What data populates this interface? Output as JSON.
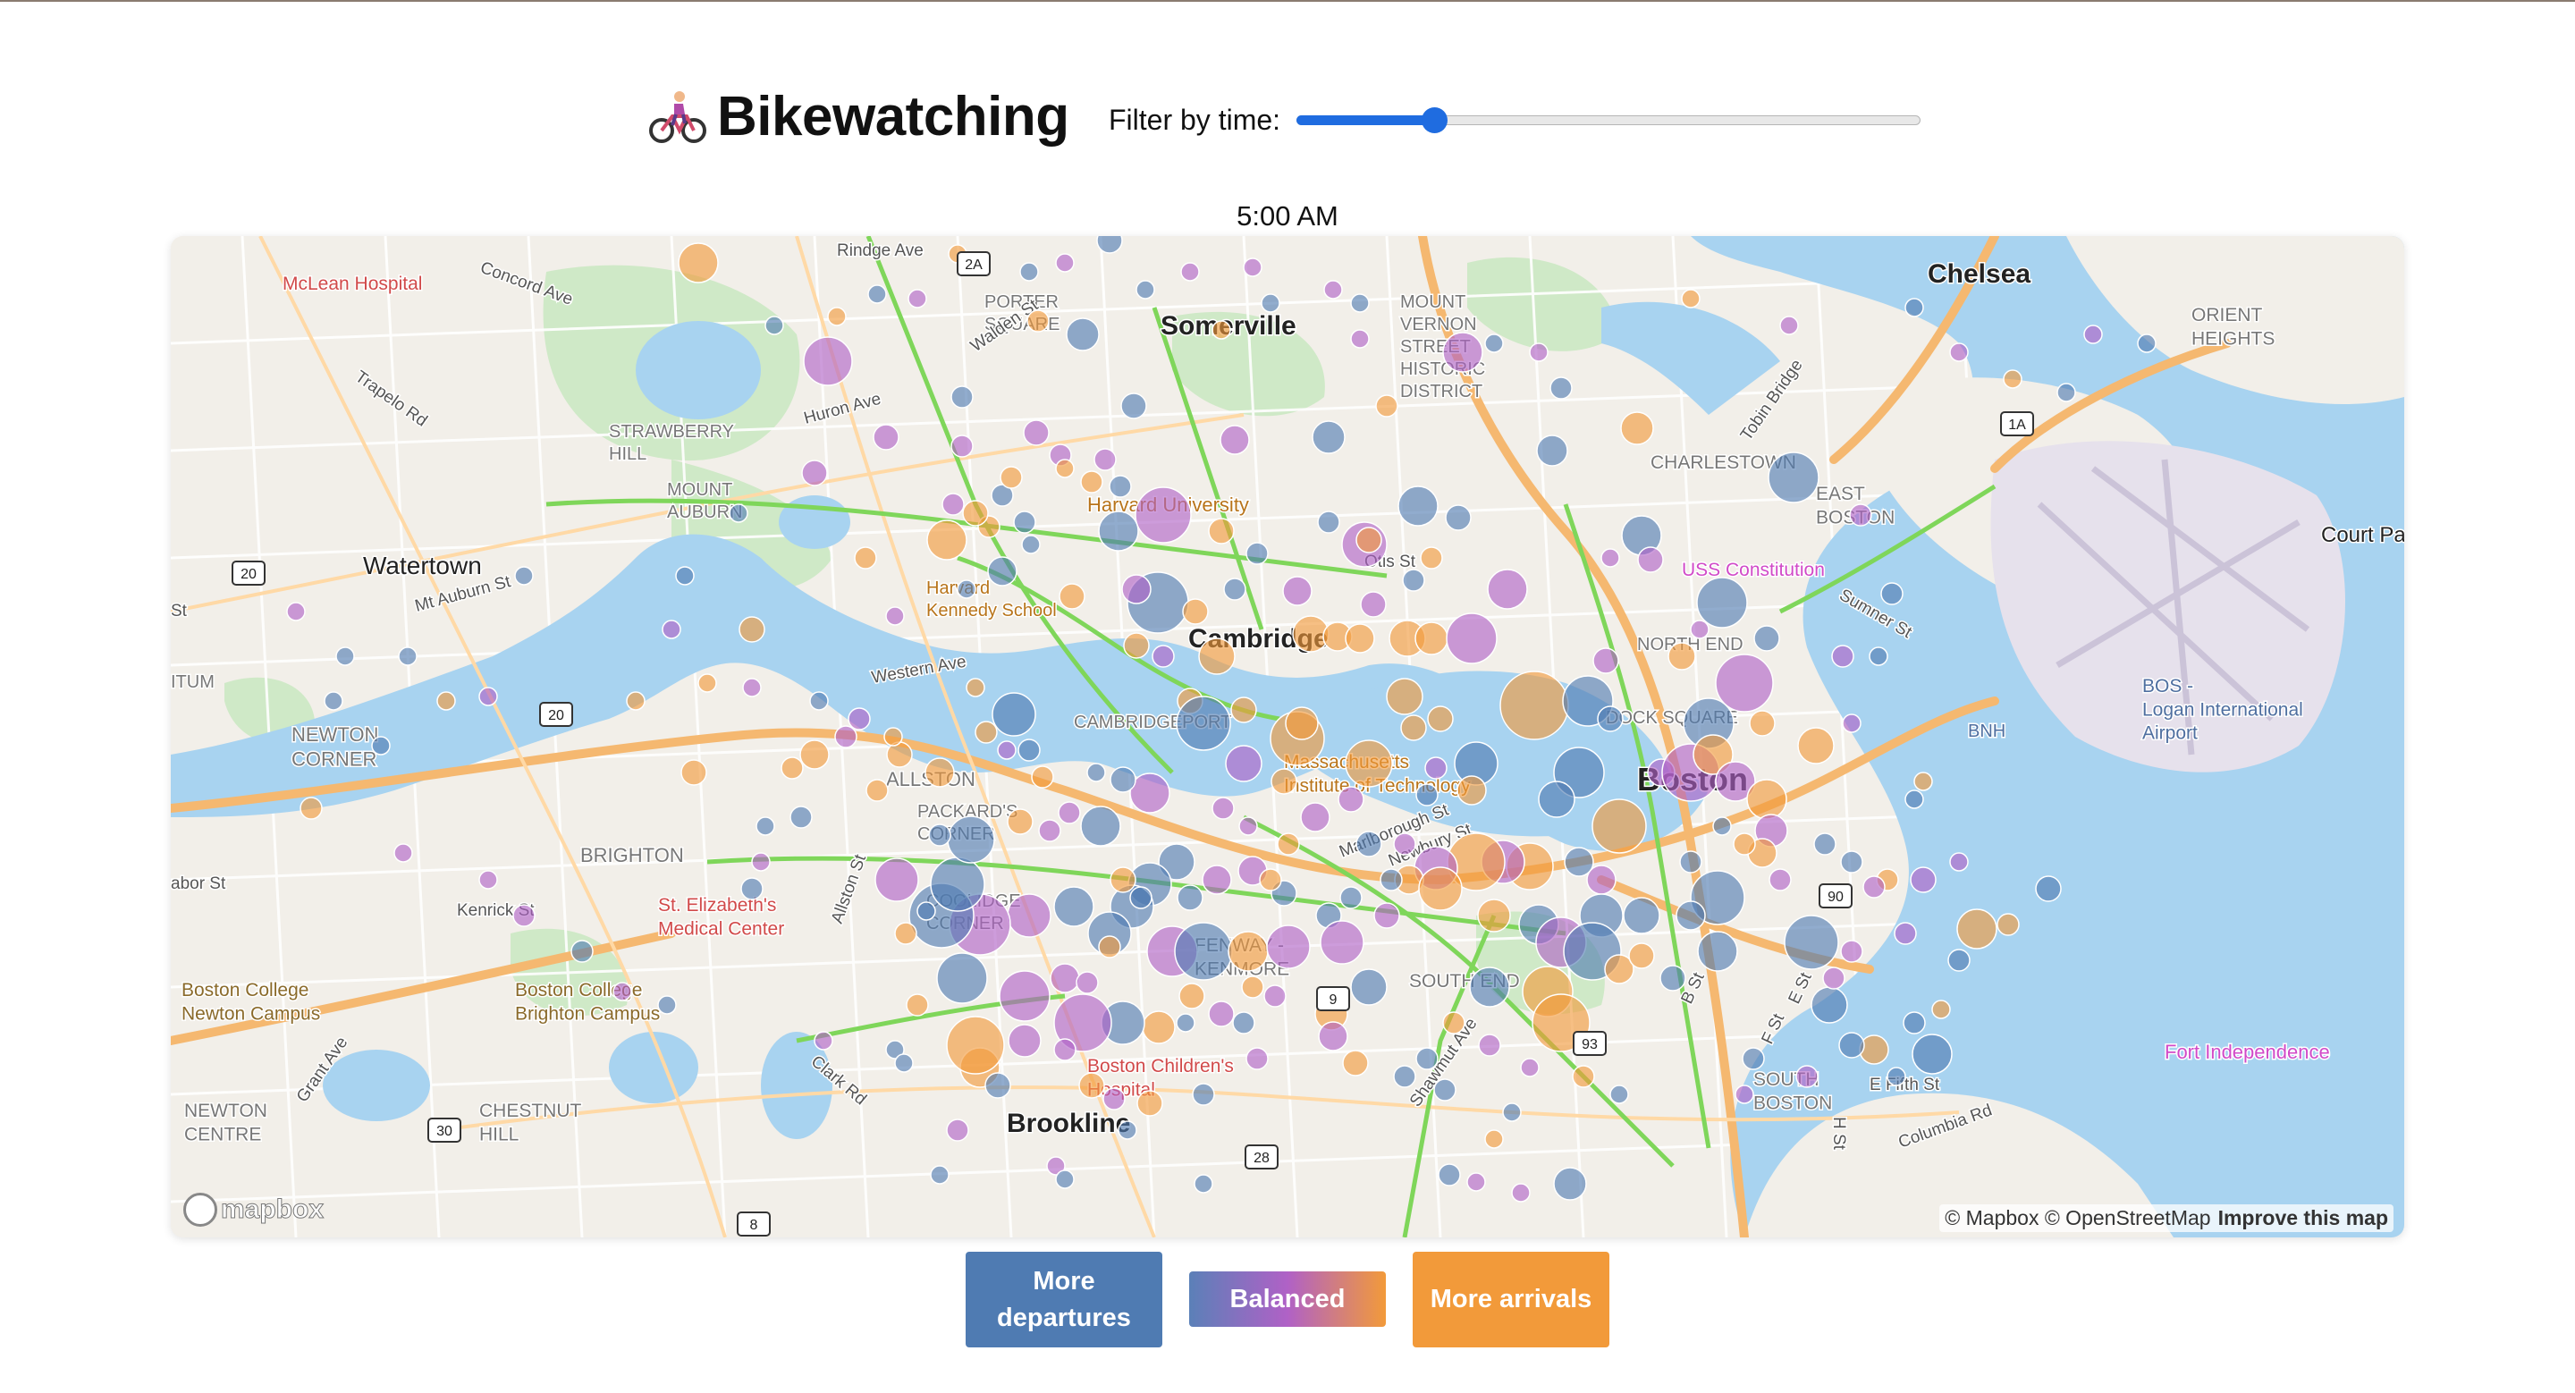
{
  "header": {
    "title": "Bikewatching",
    "title_icon": "bicyclist-icon",
    "filter_label": "Filter by time:",
    "time_value": "5:00 AM",
    "slider_fraction": 0.22
  },
  "map": {
    "attribution": "© Mapbox © OpenStreetMap",
    "improve_label": "Improve this map",
    "logo_text": "mapbox",
    "colors": {
      "water": "#a8d3f0",
      "land": "#f2efe9",
      "park": "#cfe9c7",
      "highway": "#f5b870",
      "bikeway": "#7fd65a",
      "departures": "#4f7bb2",
      "balanced": "#b061c6",
      "arrivals": "#f29a3a"
    },
    "labels": {
      "chelsea": "Chelsea",
      "somerville": "Somerville",
      "cambridge": "Cambridge",
      "boston": "Boston",
      "brookline": "Brookline",
      "watertown": "Watertown",
      "mclean": "McLean Hospital",
      "harvard": "Harvard University",
      "mit": "Massachusetts\nInstitute of Technology",
      "logan": "BOS -\nLogan International\nAirport",
      "court_park": "Court Park",
      "east_boston": "EAST\nBOSTON",
      "charlestown": "CHARLESTOWN",
      "uss": "USS Constitution",
      "fort": "Fort Independence",
      "south_boston": "SOUTH\nBOSTON",
      "allston": "ALLSTON",
      "brighton": "BRIGHTON",
      "newton_corner": "NEWTON\nCORNER",
      "bc_newton": "Boston College\nNewton Campus",
      "bc_brighton": "Boston College\nBrighton Campus",
      "st_elizabeth": "St. Elizabeth's\nMedical Center",
      "childrens": "Boston Children's\nHospital",
      "fenway": "FENWAY -\nKENMORE",
      "south_end": "SOUTH END",
      "orient_heights": "ORIENT\nHEIGHTS",
      "porter": "PORTER\nSQUARE",
      "mount_vernon": "MOUNT\nVERNON\nSTREET\nHISTORIC\nDISTRICT",
      "strawberry": "STRAWBERRY\nHILL",
      "mount_auburn": "MOUNT\nAUBURN",
      "harvard_ks": "Harvard\nKennedy School",
      "cambridgeport": "CAMBRIDGEPORT",
      "packards": "PACKARD'S\nCORNER",
      "coolidge": "COOLIDGE\nCORNER",
      "newton_centre": "NEWTON\nCENTRE",
      "chestnut_hill": "CHESTNUT\nHILL",
      "north_end": "NORTH END",
      "dock_square": "DOCK SQUARE",
      "bnh": "BNH",
      "concord_ave": "Concord Ave",
      "ridge_ave": "Rindge Ave",
      "walden": "Walden St",
      "huron": "Huron Ave",
      "trapelo": "Trapelo Rd",
      "mt_auburn": "Mt Auburn St",
      "western": "Western Ave",
      "otis": "Otis St",
      "kenrick": "Kenrick St",
      "marlborough": "Marlborough St",
      "newbury": "Newbury St",
      "sumner": "Sumner St",
      "tobin": "Tobin Bridge",
      "e_fifth": "E Fifth St",
      "columbia": "Columbia Rd",
      "clark": "Clark Rd",
      "grant": "Grant Ave",
      "shawmut": "Shawmut Ave",
      "allston_st": "Allston St",
      "b_st": "B St",
      "e_st": "E St",
      "f_st": "F St",
      "h_st": "H St",
      "harbor": "abor St",
      "st_left": "St",
      "itum": "ITUM"
    },
    "shields": [
      "2A",
      "1A",
      "20",
      "20",
      "30",
      "28",
      "9",
      "90",
      "93",
      "8"
    ]
  },
  "legend": {
    "departures": "More departures",
    "balanced": "Balanced",
    "arrivals": "More arrivals"
  }
}
